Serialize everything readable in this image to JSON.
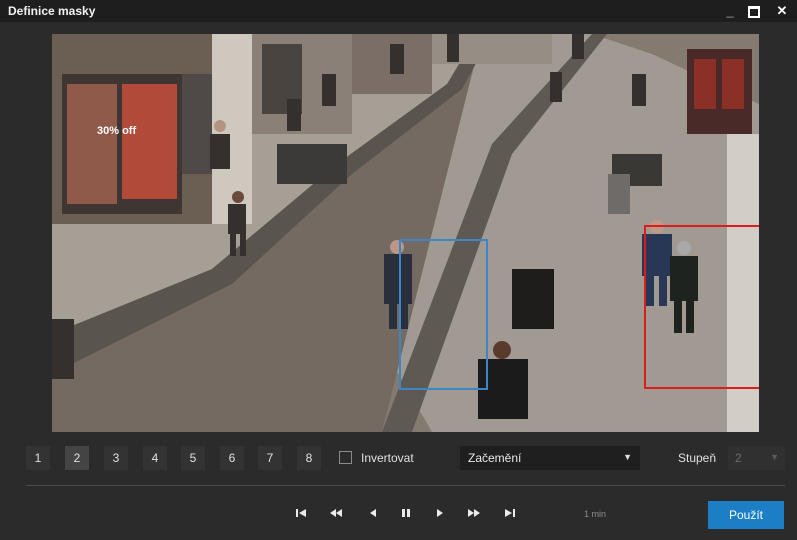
{
  "window": {
    "title": "Definice masky",
    "minimize_label": "_",
    "close_label": "✕"
  },
  "viewport": {
    "storefront_sign_text": "30% off",
    "masks": [
      {
        "name": "blue",
        "color": "#3d86c6"
      },
      {
        "name": "red",
        "color": "#e01b1b"
      }
    ]
  },
  "mask_tabs": [
    {
      "label": "1",
      "active": false
    },
    {
      "label": "2",
      "active": true
    },
    {
      "label": "3",
      "active": false
    },
    {
      "label": "4",
      "active": false
    },
    {
      "label": "5",
      "active": false
    },
    {
      "label": "6",
      "active": false
    },
    {
      "label": "7",
      "active": false
    },
    {
      "label": "8",
      "active": false
    }
  ],
  "invert": {
    "label": "Invertovat",
    "checked": false
  },
  "mode_select": {
    "value": "Začemění"
  },
  "degree": {
    "label": "Stupeň",
    "value": "2"
  },
  "playback": {
    "time_label": "1 min",
    "icons": [
      "skip-start-icon",
      "fast-backward-icon",
      "step-back-icon",
      "pause-icon",
      "play-icon",
      "fast-forward-icon",
      "skip-end-icon"
    ]
  },
  "apply_button": {
    "label": "Použít"
  },
  "colors": {
    "accent": "#1c7fc5",
    "background": "#2b2b2b"
  }
}
